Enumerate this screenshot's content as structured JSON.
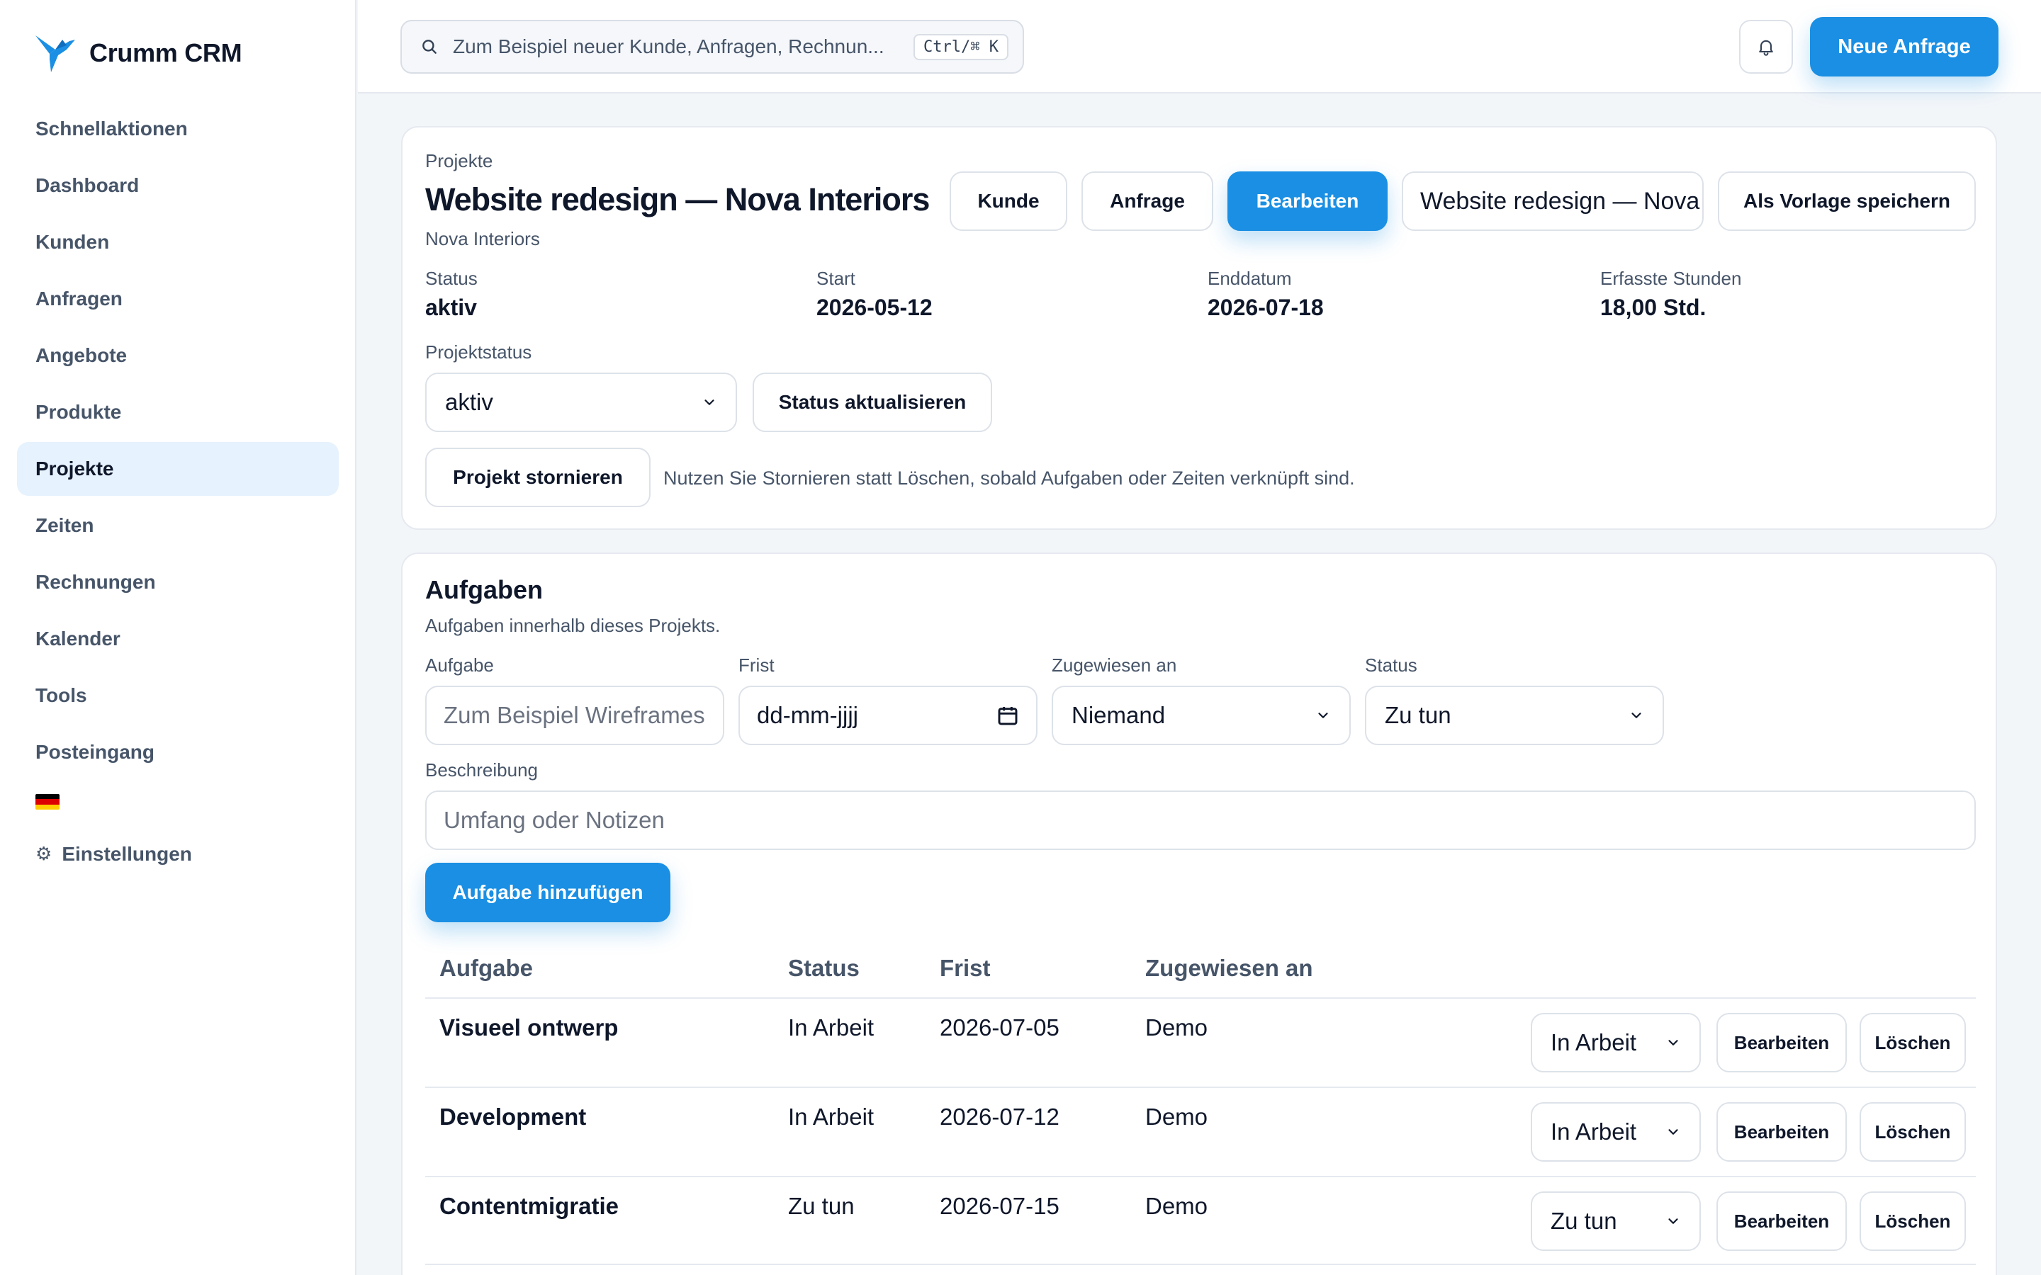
{
  "app": {
    "brand_name": "Crumm CRM"
  },
  "sidebar": {
    "items": [
      {
        "label": "Schnellaktionen"
      },
      {
        "label": "Dashboard"
      },
      {
        "label": "Kunden"
      },
      {
        "label": "Anfragen"
      },
      {
        "label": "Angebote"
      },
      {
        "label": "Produkte"
      },
      {
        "label": "Projekte",
        "active": true
      },
      {
        "label": "Zeiten"
      },
      {
        "label": "Rechnungen"
      },
      {
        "label": "Kalender"
      },
      {
        "label": "Tools"
      },
      {
        "label": "Posteingang"
      }
    ],
    "settings_label": "Einstellungen",
    "settings_glyph": "⚙"
  },
  "topbar": {
    "search_placeholder": "Zum Beispiel neuer Kunde, Anfragen, Rechnun...",
    "shortcut": "Ctrl/⌘ K",
    "new_request_label": "Neue Anfrage"
  },
  "project": {
    "breadcrumb": "Projekte",
    "title": "Website redesign — Nova Interiors",
    "client": "Nova Interiors",
    "buttons": {
      "customer": "Kunde",
      "request": "Anfrage",
      "edit": "Bearbeiten",
      "name_value": "Website redesign — Nova Interiors",
      "save_template": "Als Vorlage speichern"
    },
    "stats": [
      {
        "label": "Status",
        "value": "aktiv"
      },
      {
        "label": "Start",
        "value": "2026-05-12"
      },
      {
        "label": "Enddatum",
        "value": "2026-07-18"
      },
      {
        "label": "Erfasste Stunden",
        "value": "18,00 Std."
      }
    ],
    "status_label": "Projektstatus",
    "status_value": "aktiv",
    "update_status_label": "Status aktualisieren",
    "cancel_label": "Projekt stornieren",
    "cancel_help": "Nutzen Sie Stornieren statt Löschen, sobald Aufgaben oder Zeiten verknüpft sind."
  },
  "tasks": {
    "title": "Aufgaben",
    "subtitle": "Aufgaben innerhalb dieses Projekts.",
    "form": {
      "task_label": "Aufgabe",
      "task_placeholder": "Zum Beispiel Wireframes",
      "deadline_label": "Frist",
      "deadline_value": "dd-mm-jjjj",
      "assignee_label": "Zugewiesen an",
      "assignee_value": "Niemand",
      "status_label": "Status",
      "status_value": "Zu tun",
      "description_label": "Beschreibung",
      "description_placeholder": "Umfang oder Notizen",
      "add_label": "Aufgabe hinzufügen"
    },
    "columns": {
      "task": "Aufgabe",
      "status": "Status",
      "deadline": "Frist",
      "assignee": "Zugewiesen an"
    },
    "rows": [
      {
        "name": "Visueel ontwerp",
        "status": "In Arbeit",
        "deadline": "2026-07-05",
        "assignee": "Demo",
        "select": "In Arbeit",
        "edit": "Bearbeiten",
        "delete": "Löschen"
      },
      {
        "name": "Development",
        "status": "In Arbeit",
        "deadline": "2026-07-12",
        "assignee": "Demo",
        "select": "In Arbeit",
        "edit": "Bearbeiten",
        "delete": "Löschen"
      },
      {
        "name": "Contentmigratie",
        "status": "Zu tun",
        "deadline": "2026-07-15",
        "assignee": "Demo",
        "select": "Zu tun",
        "edit": "Bearbeiten",
        "delete": "Löschen"
      }
    ]
  },
  "colors": {
    "accent": "#1a8fe3",
    "active_bg": "#e6f2fd",
    "text": "#0f172a",
    "muted": "#475569"
  }
}
